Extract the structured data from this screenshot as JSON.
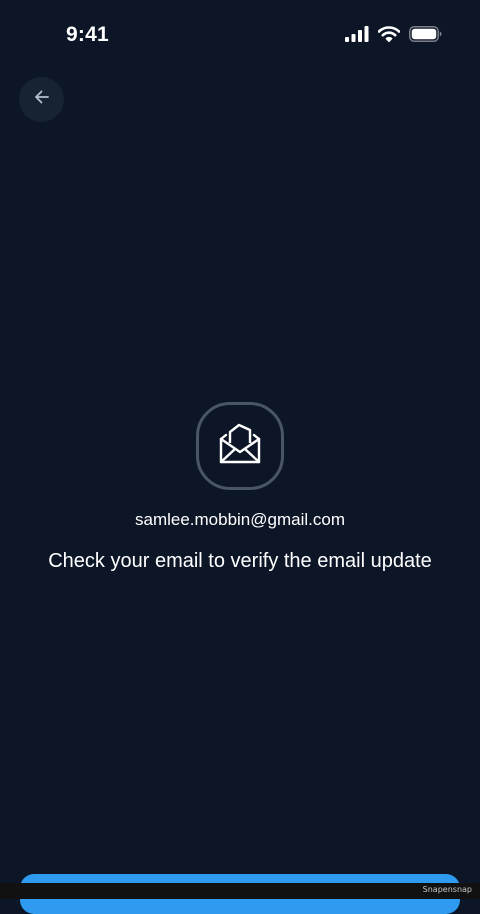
{
  "status_bar": {
    "time": "9:41",
    "icons": [
      "cellular-signal-icon",
      "wifi-icon",
      "battery-icon"
    ]
  },
  "nav": {
    "back_icon": "arrow-left-icon"
  },
  "content": {
    "badge_icon": "open-envelope-icon",
    "email": "samlee.mobbin@gmail.com",
    "message": "Check your email to verify the email update"
  },
  "footer": {
    "watermark": "Snapensnap"
  },
  "colors": {
    "background": "#0d1627",
    "accent": "#2e9bf0",
    "badge_border": "#4a5566"
  }
}
